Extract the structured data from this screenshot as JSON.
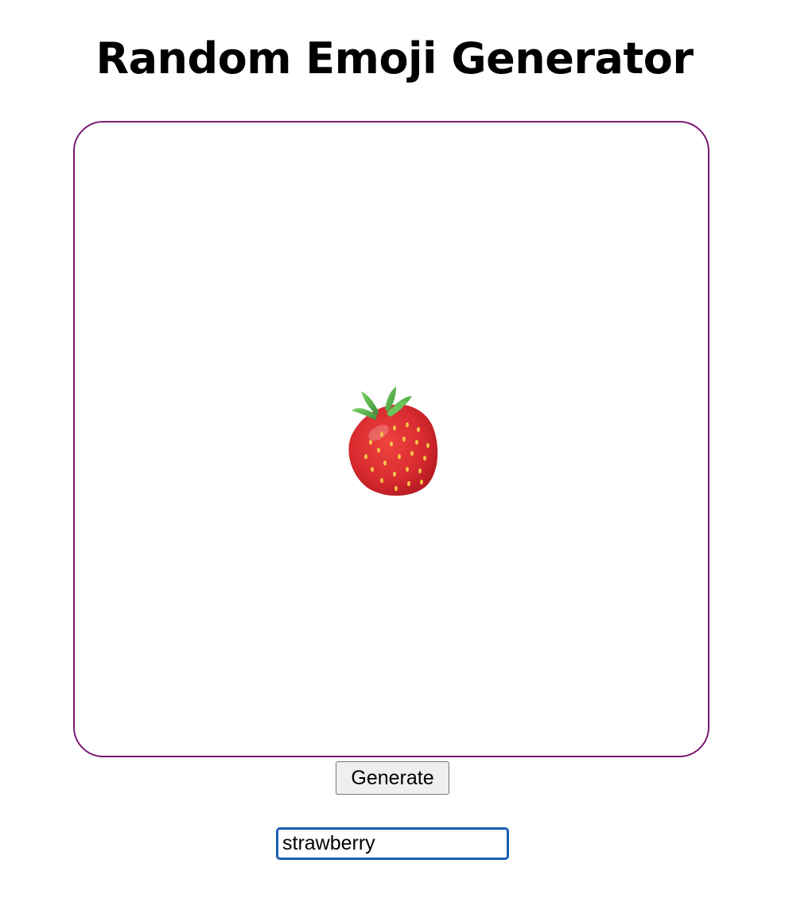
{
  "page": {
    "title": "Random Emoji Generator"
  },
  "emoji": {
    "current": "strawberry",
    "icon": "strawberry-emoji-icon"
  },
  "controls": {
    "generate_label": "Generate",
    "input_value": "strawberry"
  },
  "colors": {
    "frame_border": "#7a1a74",
    "input_focus": "#1a5fb4",
    "button_bg": "#efefef",
    "strawberry_red": "#d62a2f",
    "leaf_green": "#52b043",
    "seed_yellow": "#f4c04a"
  }
}
